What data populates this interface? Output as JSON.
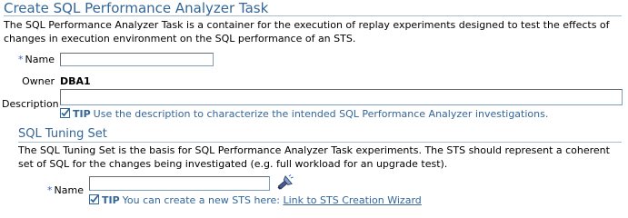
{
  "page": {
    "title": "Create SQL Performance Analyzer Task",
    "intro": "The SQL Performance Analyzer Task is a container for the execution of replay experiments designed to test the effects of changes in execution environment on the SQL performance of an STS."
  },
  "task_form": {
    "required_mark": "*",
    "name_label": "Name",
    "name_value": "",
    "owner_label": "Owner",
    "owner_value": "DBA1",
    "description_label": "Description",
    "description_value": "",
    "tip_label": "TIP",
    "tip_text": "Use the description to characterize the intended SQL Performance Analyzer investigations."
  },
  "sts_section": {
    "title": "SQL Tuning Set",
    "intro": "The SQL Tuning Set is the basis for SQL Performance Analyzer Task experiments. The STS should represent a coherent set of SQL for the changes being investigated (e.g. full workload for an upgrade test).",
    "required_mark": "*",
    "name_label": "Name",
    "name_value": "",
    "tip_label": "TIP",
    "tip_text": "You can create a new STS here:",
    "link_text": "Link to STS Creation Wizard",
    "search_icon": "flashlight-search-icon"
  },
  "colors": {
    "heading": "#336699",
    "required": "#3366cc",
    "tip_check": "#336699"
  }
}
